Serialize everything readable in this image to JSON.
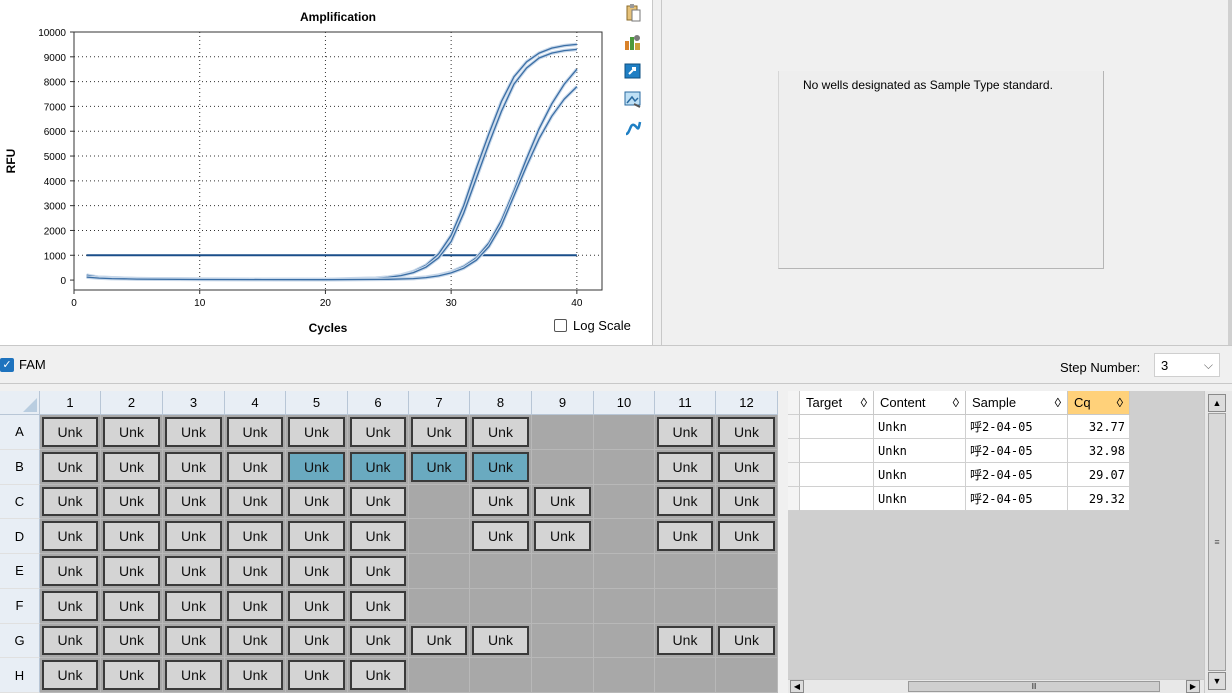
{
  "chart_data": {
    "type": "line",
    "title": "Amplification",
    "xlabel": "Cycles",
    "ylabel": "RFU",
    "xlim": [
      0,
      42
    ],
    "ylim": [
      -400,
      10000
    ],
    "x_ticks": [
      0,
      10,
      20,
      30,
      40
    ],
    "y_ticks": [
      0,
      1000,
      2000,
      3000,
      4000,
      5000,
      6000,
      7000,
      8000,
      9000,
      10000
    ],
    "grid": "dotted",
    "threshold": 1000,
    "series": [
      {
        "x": [
          1,
          2,
          3,
          4,
          5,
          10,
          15,
          20,
          22,
          24,
          25,
          26,
          27,
          28,
          29,
          30,
          31,
          32,
          33,
          34,
          35,
          36,
          37,
          38,
          39,
          40
        ],
        "values": [
          180,
          110,
          90,
          70,
          60,
          40,
          30,
          25,
          50,
          80,
          120,
          200,
          350,
          600,
          1050,
          1800,
          3000,
          4500,
          5900,
          7200,
          8200,
          8800,
          9150,
          9350,
          9450,
          9500
        ]
      },
      {
        "x": [
          1,
          2,
          3,
          4,
          5,
          10,
          15,
          20,
          22,
          24,
          25,
          26,
          27,
          28,
          29,
          30,
          31,
          32,
          33,
          34,
          35,
          36,
          37,
          38,
          39,
          40
        ],
        "values": [
          150,
          100,
          80,
          60,
          50,
          30,
          25,
          20,
          40,
          70,
          110,
          180,
          300,
          520,
          900,
          1550,
          2700,
          4100,
          5500,
          6800,
          7900,
          8550,
          8950,
          9150,
          9250,
          9300
        ]
      },
      {
        "x": [
          1,
          2,
          3,
          4,
          5,
          10,
          15,
          20,
          25,
          27,
          28,
          29,
          30,
          31,
          32,
          33,
          34,
          35,
          36,
          37,
          38,
          39,
          40
        ],
        "values": [
          200,
          110,
          90,
          70,
          60,
          40,
          30,
          25,
          40,
          80,
          120,
          200,
          330,
          550,
          900,
          1500,
          2400,
          3600,
          4900,
          6100,
          7100,
          7900,
          8500
        ]
      },
      {
        "x": [
          1,
          2,
          3,
          4,
          5,
          10,
          15,
          20,
          25,
          27,
          28,
          29,
          30,
          31,
          32,
          33,
          34,
          35,
          36,
          37,
          38,
          39,
          40
        ],
        "values": [
          120,
          80,
          60,
          50,
          40,
          25,
          20,
          15,
          30,
          60,
          100,
          170,
          290,
          480,
          800,
          1350,
          2200,
          3400,
          4600,
          5700,
          6600,
          7300,
          7800
        ]
      }
    ],
    "series_color": "#3a6ea5",
    "threshold_color": "#1a4f8a"
  },
  "chart_ui": {
    "log_scale_label": "Log Scale",
    "log_scale_checked": false
  },
  "standard_curve": {
    "message": "No wells designated as Sample Type standard."
  },
  "fluor": {
    "label": "FAM",
    "checked": true,
    "check_glyph": "✓"
  },
  "step": {
    "label": "Step Number:",
    "value": "3",
    "arrow": "⌵"
  },
  "plate": {
    "columns": [
      "1",
      "2",
      "3",
      "4",
      "5",
      "6",
      "7",
      "8",
      "9",
      "10",
      "11",
      "12"
    ],
    "rows": [
      "A",
      "B",
      "C",
      "D",
      "E",
      "F",
      "G",
      "H"
    ],
    "wells": [
      [
        "Unk",
        "Unk",
        "Unk",
        "Unk",
        "Unk",
        "Unk",
        "Unk",
        "Unk",
        "",
        "",
        "Unk",
        "Unk"
      ],
      [
        "Unk",
        "Unk",
        "Unk",
        "Unk",
        "Unk",
        "Unk",
        "Unk",
        "Unk",
        "",
        "",
        "Unk",
        "Unk"
      ],
      [
        "Unk",
        "Unk",
        "Unk",
        "Unk",
        "Unk",
        "Unk",
        "",
        "Unk",
        "Unk",
        "",
        "Unk",
        "Unk"
      ],
      [
        "Unk",
        "Unk",
        "Unk",
        "Unk",
        "Unk",
        "Unk",
        "",
        "Unk",
        "Unk",
        "",
        "Unk",
        "Unk"
      ],
      [
        "Unk",
        "Unk",
        "Unk",
        "Unk",
        "Unk",
        "Unk",
        "",
        "",
        "",
        "",
        "",
        ""
      ],
      [
        "Unk",
        "Unk",
        "Unk",
        "Unk",
        "Unk",
        "Unk",
        "",
        "",
        "",
        "",
        "",
        ""
      ],
      [
        "Unk",
        "Unk",
        "Unk",
        "Unk",
        "Unk",
        "Unk",
        "Unk",
        "Unk",
        "",
        "",
        "Unk",
        "Unk"
      ],
      [
        "Unk",
        "Unk",
        "Unk",
        "Unk",
        "Unk",
        "Unk",
        "",
        "",
        "",
        "",
        "",
        ""
      ]
    ],
    "selected": [
      [
        1,
        4
      ],
      [
        1,
        5
      ],
      [
        1,
        6
      ],
      [
        1,
        7
      ]
    ]
  },
  "results_table": {
    "headers": [
      "Target",
      "Content",
      "Sample",
      "Cq"
    ],
    "sort_glyph": "◊",
    "sorted_column": 3,
    "rows": [
      [
        "",
        "Unkn",
        "呼2-04-05",
        "32.77"
      ],
      [
        "",
        "Unkn",
        "呼2-04-05",
        "32.98"
      ],
      [
        "",
        "Unkn",
        "呼2-04-05",
        "29.07"
      ],
      [
        "",
        "Unkn",
        "呼2-04-05",
        "29.32"
      ]
    ]
  },
  "icons": [
    "clipboard-icon",
    "chart-settings-icon",
    "export-icon",
    "image-icon",
    "curve-style-icon"
  ]
}
